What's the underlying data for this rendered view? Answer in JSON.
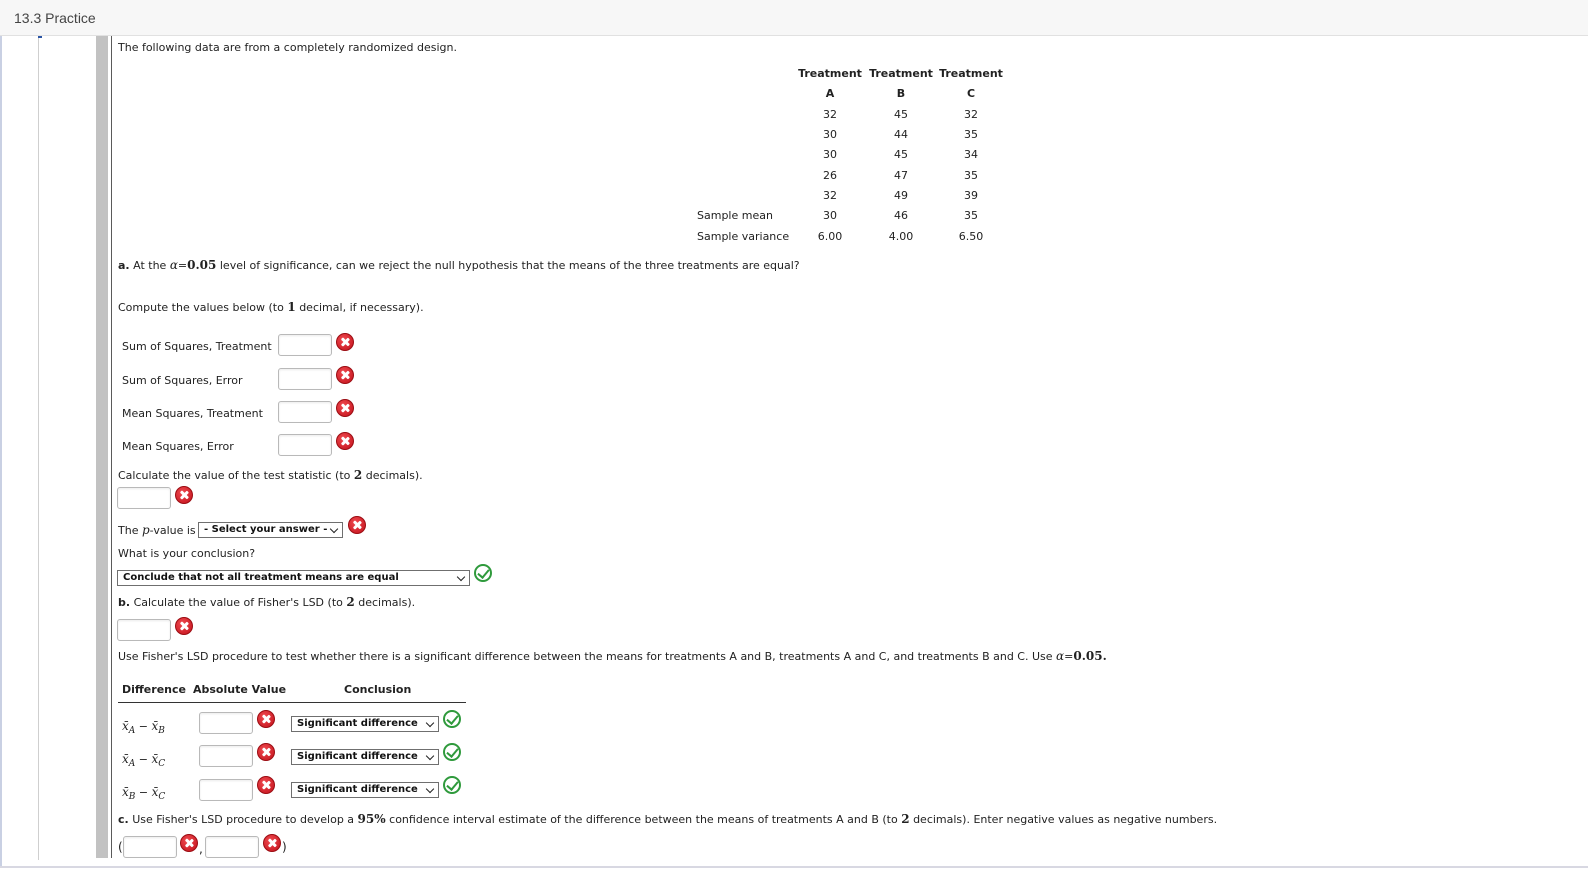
{
  "header": {
    "title": "13.3 Practice"
  },
  "intro": "The following data are from a completely randomized design.",
  "table": {
    "header_line1": [
      "Treatment",
      "Treatment",
      "Treatment"
    ],
    "header_line2": [
      "A",
      "B",
      "C"
    ],
    "rows": [
      [
        "32",
        "45",
        "32"
      ],
      [
        "30",
        "44",
        "35"
      ],
      [
        "30",
        "45",
        "34"
      ],
      [
        "26",
        "47",
        "35"
      ],
      [
        "32",
        "49",
        "39"
      ]
    ],
    "sample_mean_label": "Sample mean",
    "sample_mean": [
      "30",
      "46",
      "35"
    ],
    "sample_variance_label": "Sample variance",
    "sample_variance": [
      "6.00",
      "4.00",
      "6.50"
    ]
  },
  "part_a": {
    "label": "a.",
    "q_prefix": "At the",
    "alpha_symbol": "α",
    "eq": "=",
    "alpha_value": "0.05",
    "q_suffix": "level of significance, can we reject the null hypothesis that the means of the three treatments are equal?",
    "compute_prefix": "Compute the values below (to",
    "compute_decimals": "1",
    "compute_suffix": "decimal, if necessary).",
    "fields": [
      {
        "label": "Sum of Squares, Treatment",
        "value": ""
      },
      {
        "label": "Sum of Squares, Error",
        "value": ""
      },
      {
        "label": "Mean Squares, Treatment",
        "value": ""
      },
      {
        "label": "Mean Squares, Error",
        "value": ""
      }
    ],
    "test_stat_prefix": "Calculate the value of the test statistic (to",
    "test_stat_decimals": "2",
    "test_stat_suffix": "decimals).",
    "pvalue_prefix": "The",
    "pvalue_symbol": "p",
    "pvalue_suffix": "-value is",
    "pvalue_select": "- Select your answer -",
    "conclusion_q": "What is your conclusion?",
    "conclusion_select": "Conclude that not all treatment means are equal"
  },
  "part_b": {
    "label": "b.",
    "text_prefix": "Calculate the value of Fisher's LSD (to",
    "decimals": "2",
    "text_suffix": "decimals).",
    "procedure_text": "Use Fisher's LSD procedure to test whether there is a significant difference between the means for treatments A and B, treatments A and C, and treatments B and C. Use",
    "alpha_symbol": "α",
    "eq": "=",
    "alpha_value": "0.05.",
    "col_difference": "Difference",
    "col_absolute": "Absolute Value",
    "col_conclusion": "Conclusion",
    "rows": [
      {
        "diff_a": "x̄",
        "sub_a": "A",
        "minus": "−",
        "diff_b": "x̄",
        "sub_b": "B",
        "conclusion": "Significant difference"
      },
      {
        "diff_a": "x̄",
        "sub_a": "A",
        "minus": "−",
        "diff_b": "x̄",
        "sub_b": "C",
        "conclusion": "Significant difference"
      },
      {
        "diff_a": "x̄",
        "sub_a": "B",
        "minus": "−",
        "diff_b": "x̄",
        "sub_b": "C",
        "conclusion": "Significant difference"
      }
    ]
  },
  "part_c": {
    "label": "c.",
    "text_prefix": "Use Fisher's LSD procedure to develop a",
    "confidence": "95%",
    "text_middle": "confidence interval estimate of the difference between the means of treatments A and B (to",
    "decimals": "2",
    "text_suffix": "decimals). Enter negative values as negative numbers.",
    "open_paren": "(",
    "comma": ",",
    "close_paren": ")"
  }
}
